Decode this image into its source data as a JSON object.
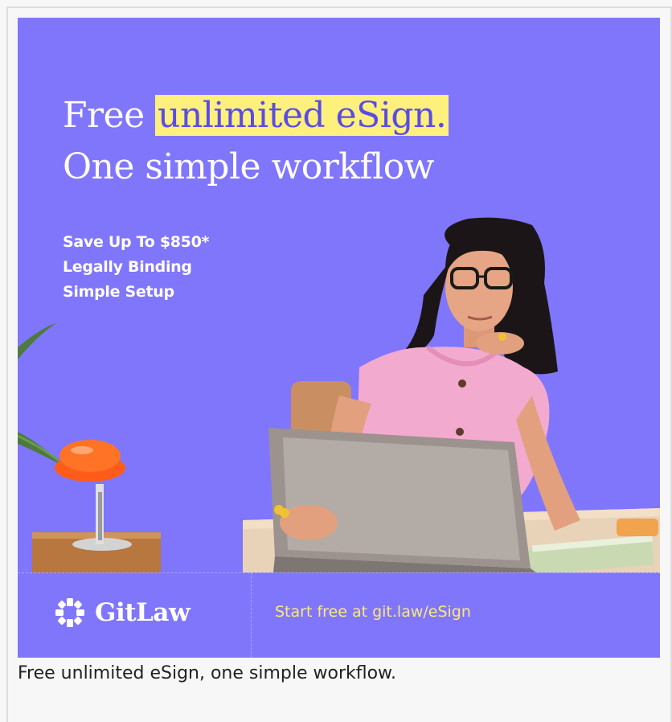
{
  "ad": {
    "headline_prefix": "Free ",
    "headline_highlight": "unlimited eSign.",
    "headline_line2": "One simple workflow",
    "bullets": [
      "Save Up To $850*",
      "Legally Binding",
      "Simple Setup"
    ],
    "brand": "GitLaw",
    "brand_icon": "gitlaw-logo-icon",
    "cta": "Start free at git.law/eSign",
    "photo": "woman-with-laptop-photo",
    "colors": {
      "background": "#8076fb",
      "highlight": "#fdf07c",
      "cta": "#fbe97b"
    }
  },
  "caption": "Free unlimited eSign, one simple workflow."
}
